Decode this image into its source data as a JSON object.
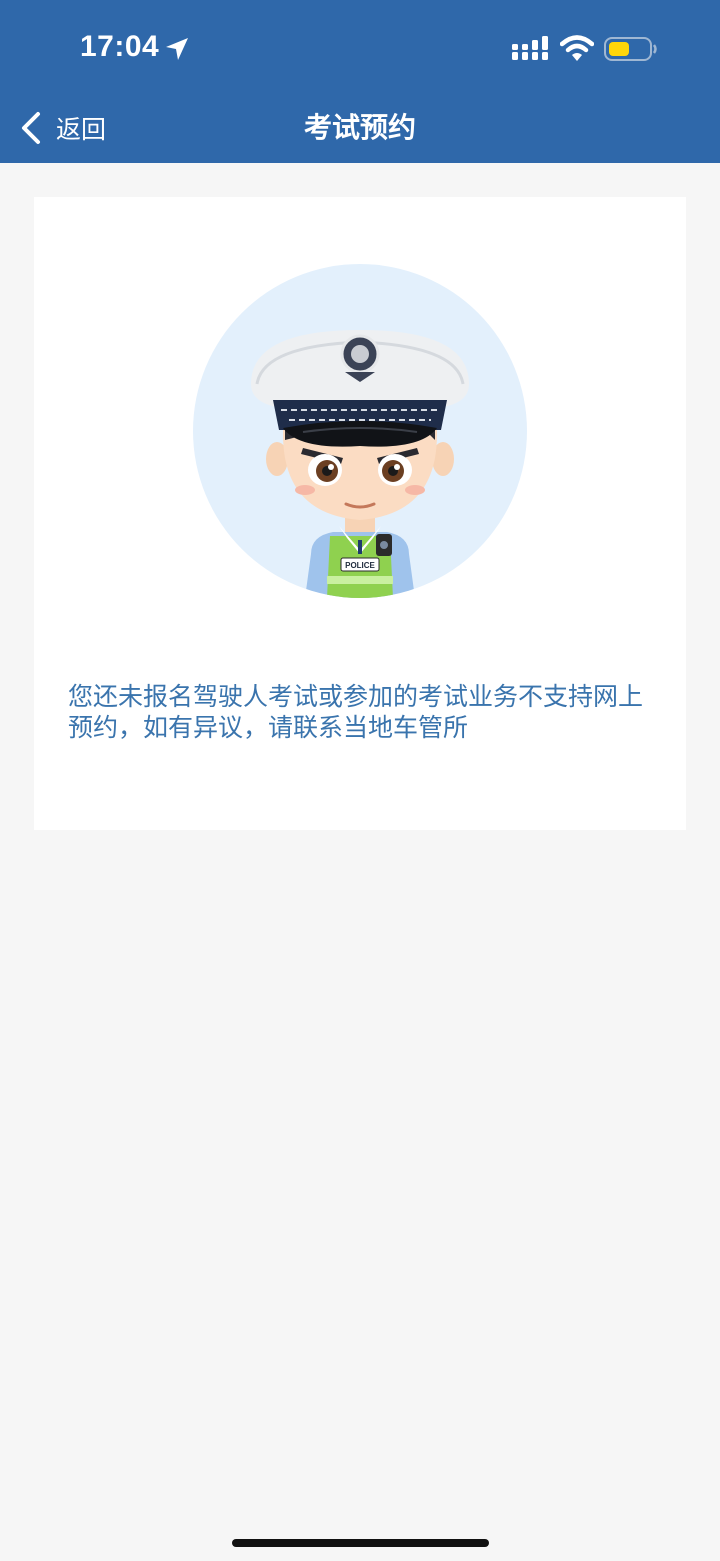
{
  "status_bar": {
    "time": "17:04"
  },
  "nav": {
    "back_label": "返回",
    "title": "考试预约"
  },
  "card": {
    "badge_text": "POLICE",
    "message": "您还未报名驾驶人考试或参加的考试业务不支持网上预约，如有异议，请联系当地车管所"
  },
  "colors": {
    "header": "#2f68aa",
    "message_text": "#3a74ad",
    "page_background": "#f6f6f6",
    "avatar_circle": "#e3f0fc",
    "battery_fill": "#ffd60a"
  },
  "icons": {
    "location": "location-arrow-icon",
    "signal": "cellular-signal-icon",
    "wifi": "wifi-icon",
    "battery": "battery-icon",
    "back": "chevron-left-icon"
  }
}
